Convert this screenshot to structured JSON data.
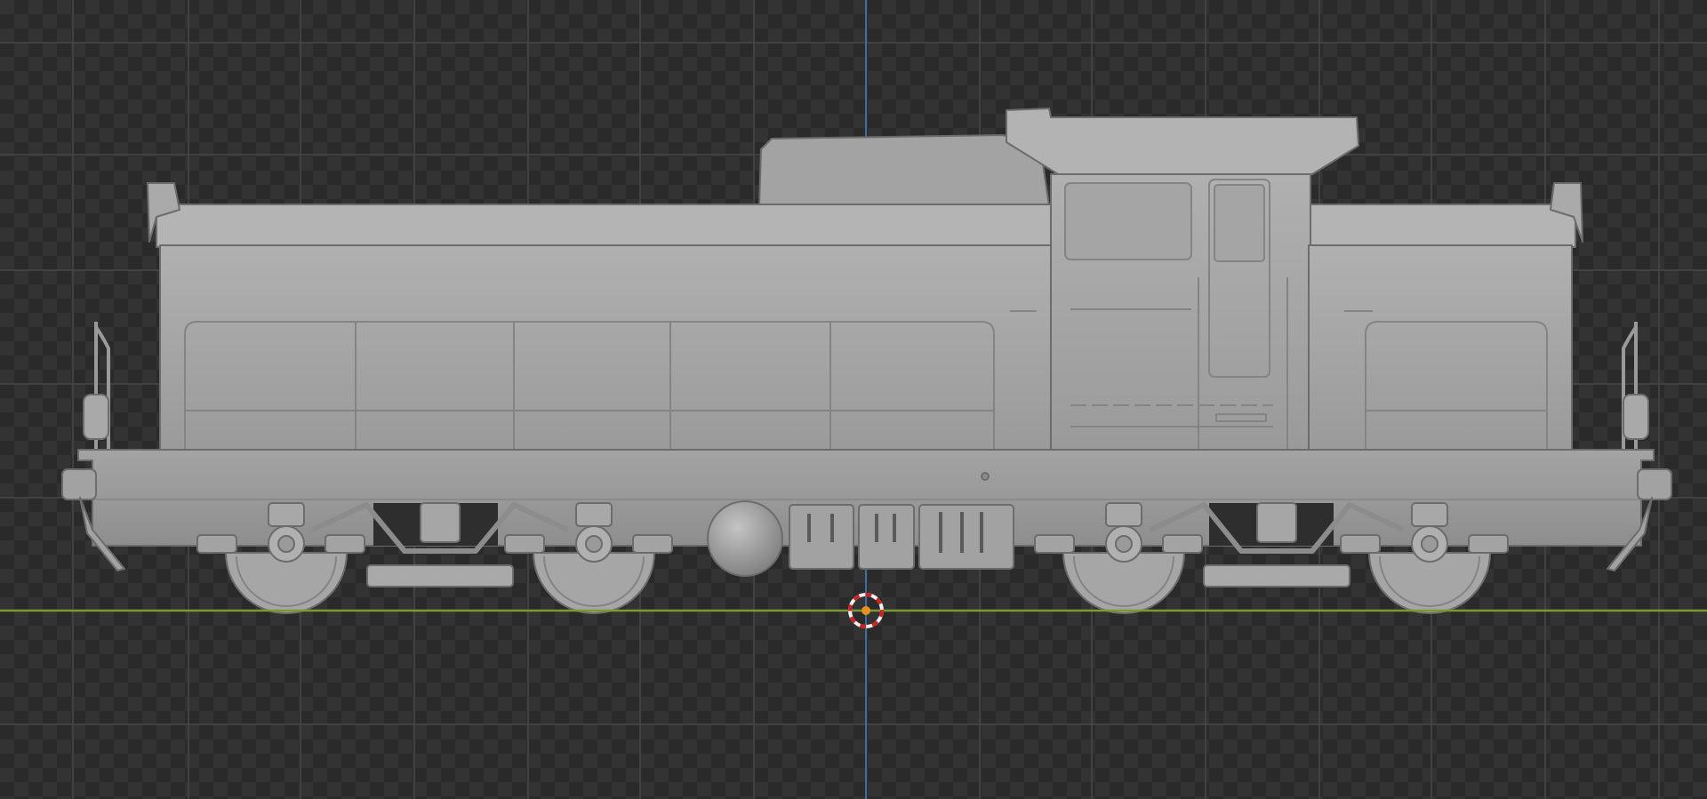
{
  "viewport": {
    "mode": "orthographic-side-view",
    "background_style": "transparent-checker",
    "colors": {
      "checker_dark": "#2a2a2a",
      "checker_light": "#333333",
      "grid_line": "#474747",
      "x_axis": "#7a9a35",
      "z_axis": "#3a6f9e",
      "model_light": "#a9a9a9",
      "model_mid": "#9b9b9b",
      "model_dark": "#7e7e7e",
      "model_edge": "#6c6c6c",
      "cursor_red": "#d02020",
      "cursor_white": "#f0f0f0",
      "origin_orange": "#e8901e"
    }
  },
  "scene_object": {
    "name": "diesel-locomotive",
    "shading": "solid"
  }
}
